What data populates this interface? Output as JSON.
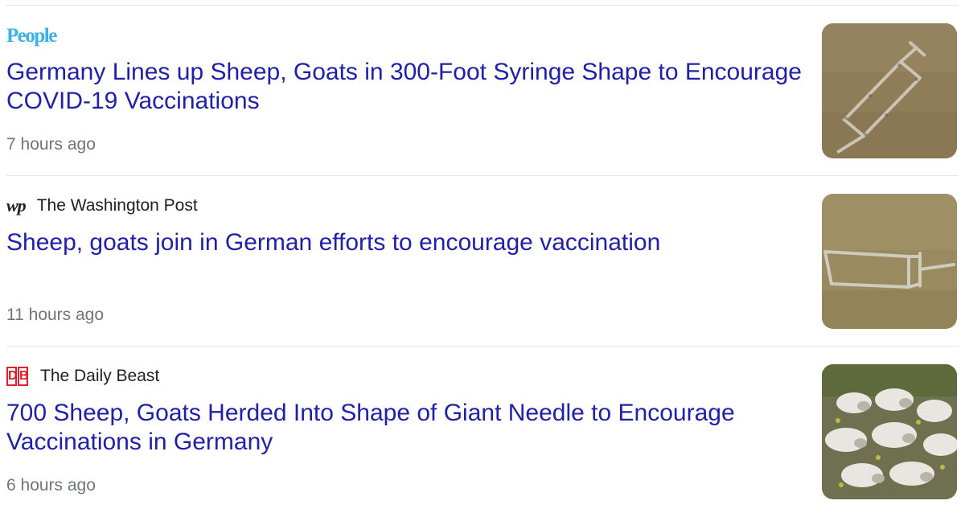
{
  "articles": [
    {
      "source": {
        "name": "People",
        "logo": "people-logo",
        "logo_color": "#3fb0e6"
      },
      "headline": "Germany Lines up Sheep, Goats in 300-Foot Syringe Shape to Encourage COVID-19 Vaccinations",
      "time": "7 hours ago"
    },
    {
      "source": {
        "name": "The Washington Post",
        "logo": "washington-post-logo",
        "logo_text": "wp"
      },
      "headline": "Sheep, goats join in German efforts to encourage vaccination",
      "time": "11 hours ago"
    },
    {
      "source": {
        "name": "The Daily Beast",
        "logo": "daily-beast-logo",
        "logo_text": [
          "D",
          "B"
        ],
        "logo_color": "#e0202a"
      },
      "headline": "700 Sheep, Goats Herded Into Shape of Giant Needle to Encourage Vaccinations in Germany",
      "time": "6 hours ago"
    }
  ],
  "colors": {
    "headline": "#1f1fa8",
    "meta_text": "#70757a",
    "source_text": "#202124",
    "divider": "#e3e3e3"
  }
}
